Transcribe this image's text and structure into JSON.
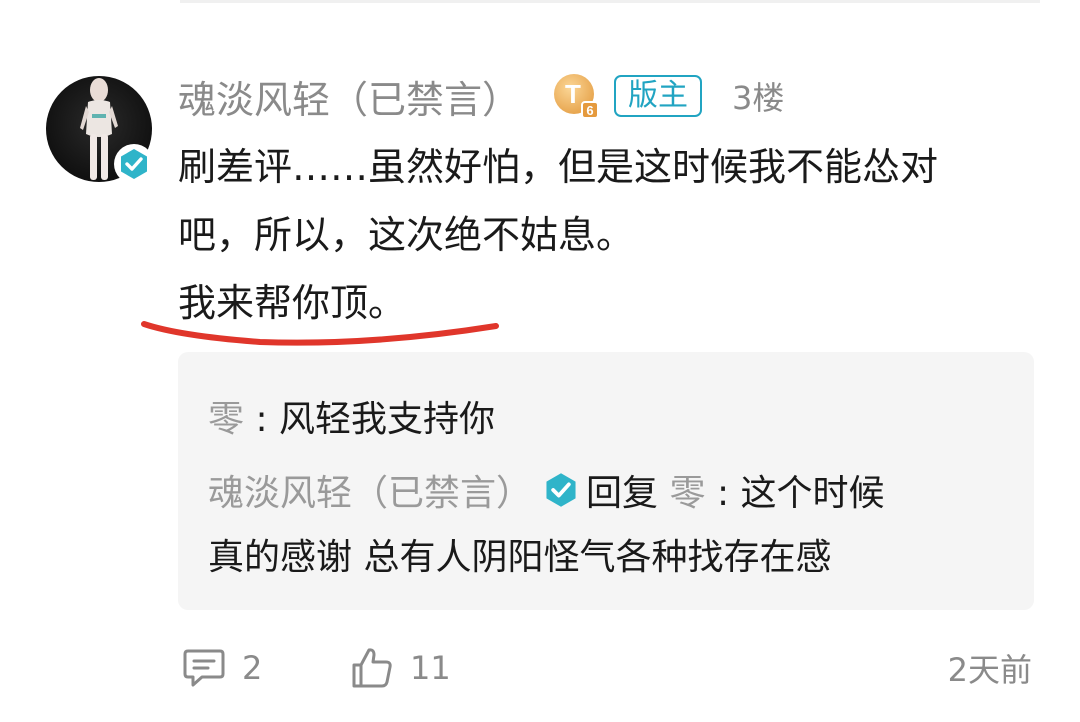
{
  "post": {
    "username": "魂淡风轻（已禁言）",
    "level_badge": "T",
    "level_number": "6",
    "mod_badge": "版主",
    "floor": "3楼",
    "content_lines": [
      "刷差评……虽然好怕，但是这时候我不能怂对",
      "吧，所以，这次绝不姑息。",
      "我来帮你顶。"
    ],
    "annotation_color": "#e0362b"
  },
  "replies": {
    "reply1_author": "零",
    "reply1_sep": " : ",
    "reply1_text": "风轻我支持你",
    "reply2_author": "魂淡风轻（已禁言）",
    "reply2_action": "回复",
    "reply2_target": "零",
    "reply2_sep": " : ",
    "reply2_text_line1": "这个时候",
    "reply2_text_line2": "真的感谢 总有人阴阳怪气各种找存在感"
  },
  "footer": {
    "comment_count": "2",
    "like_count": "11",
    "time": "2天前"
  },
  "colors": {
    "accent": "#21a4c2",
    "verified": "#2fb4c9",
    "level_badge": "#f0b35a",
    "muted_text": "#8a8a8a",
    "reply_bg": "#f5f5f5"
  },
  "icons": {
    "avatar_badge": "verified-check-icon",
    "reply_verified": "verified-check-icon",
    "comment": "comment-icon",
    "like": "thumbs-up-icon"
  }
}
